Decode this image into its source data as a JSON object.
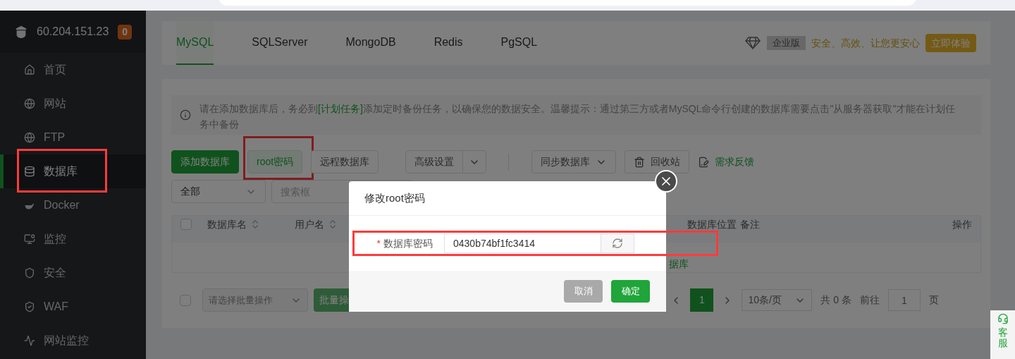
{
  "server": {
    "ip": "60.204.151.23",
    "badge": "0"
  },
  "sidebar": {
    "items": [
      {
        "label": "首页",
        "selected": false,
        "highlighted": false
      },
      {
        "label": "网站",
        "selected": false,
        "highlighted": false
      },
      {
        "label": "FTP",
        "selected": false,
        "highlighted": false
      },
      {
        "label": "数据库",
        "selected": true,
        "highlighted": true
      },
      {
        "label": "Docker",
        "selected": false,
        "highlighted": false
      },
      {
        "label": "监控",
        "selected": false,
        "highlighted": false
      },
      {
        "label": "安全",
        "selected": false,
        "highlighted": false
      },
      {
        "label": "WAF",
        "selected": false,
        "highlighted": false
      },
      {
        "label": "网站监控",
        "selected": false,
        "highlighted": false
      }
    ]
  },
  "tabs": [
    {
      "label": "MySQL",
      "selected": true
    },
    {
      "label": "SQLServer",
      "selected": false
    },
    {
      "label": "MongoDB",
      "selected": false
    },
    {
      "label": "Redis",
      "selected": false
    },
    {
      "label": "PgSQL",
      "selected": false
    }
  ],
  "promo": {
    "edition": "企业版",
    "slogan": "安全、高效、让您更安心",
    "button": "立即体验"
  },
  "notice": {
    "before": "请在添加数据库后，务必到",
    "link": "[计划任务]",
    "after": "添加定时备份任务，以确保您的数据安全。温馨提示：通过第三方或者MySQL命令行创建的数据库需要点击\"从服务器获取\"才能在计划任务中备份"
  },
  "toolbar": [
    {
      "label": "添加数据库",
      "kind": "primary",
      "highlighted": false
    },
    {
      "label": "root密码",
      "kind": "default",
      "highlighted": true
    },
    {
      "label": "远程数据库",
      "kind": "default",
      "highlighted": false
    },
    {
      "label": "高级设置",
      "kind": "split",
      "highlighted": false
    },
    {
      "label": "同步数据库",
      "kind": "dropdown",
      "highlighted": false
    },
    {
      "label": "回收站",
      "kind": "trash",
      "highlighted": false
    },
    {
      "label": "需求反馈",
      "kind": "feedback",
      "highlighted": false
    }
  ],
  "filter": {
    "select": "全部",
    "search_placeholder": "搜索框"
  },
  "table": {
    "select_all_checked": false,
    "columns": [
      {
        "label": "数据库名",
        "sortable": true
      },
      {
        "label": "用户名",
        "sortable": true
      },
      {
        "label": "数据库位置",
        "sortable": false
      },
      {
        "label": "备注",
        "sortable": false
      },
      {
        "label": "操作",
        "sortable": false
      }
    ],
    "empty_text": "据库"
  },
  "batch": {
    "checked": false,
    "select_placeholder": "请选择批量操作",
    "button": "批量操"
  },
  "pagination": {
    "page": "1",
    "page_size": "10条/页",
    "total": "共 0 条",
    "goto": "前往",
    "goto_value": "1",
    "page_unit": "页"
  },
  "support": "客服",
  "dialog": {
    "title": "修改root密码",
    "required_mark": "*",
    "field_label": "数据库密码",
    "value": "0430b74bf1fc3414",
    "highlighted": true,
    "buttons": [
      {
        "label": "取消",
        "kind": "cancel"
      },
      {
        "label": "确定",
        "kind": "confirm"
      }
    ]
  }
}
